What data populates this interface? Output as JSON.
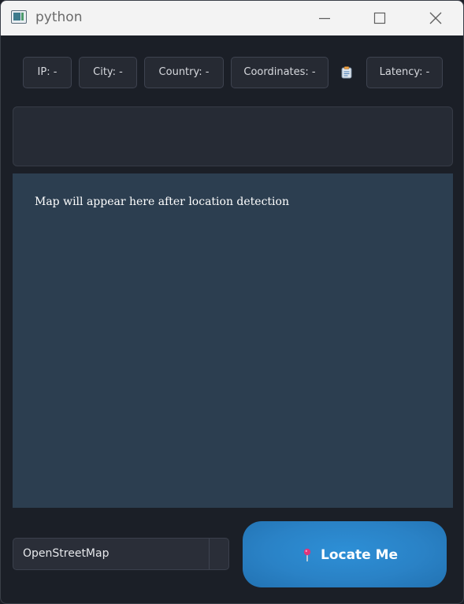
{
  "window": {
    "title": "python"
  },
  "info_bar": {
    "ip_label": "IP: -",
    "city_label": "City: -",
    "country_label": "Country: -",
    "coordinates_label": "Coordinates: -",
    "copy_icon": "clipboard-icon",
    "latency_label": "Latency: -"
  },
  "status_panel": {
    "text": ""
  },
  "map": {
    "placeholder": "Map will appear here after location detection"
  },
  "controls": {
    "provider_selected": "OpenStreetMap",
    "locate_label": "Locate Me",
    "locate_icon": "pin-icon"
  },
  "colors": {
    "map_background": "#2c3e50",
    "locate_button": "#2a82c6",
    "window_background": "#1b1f27"
  }
}
